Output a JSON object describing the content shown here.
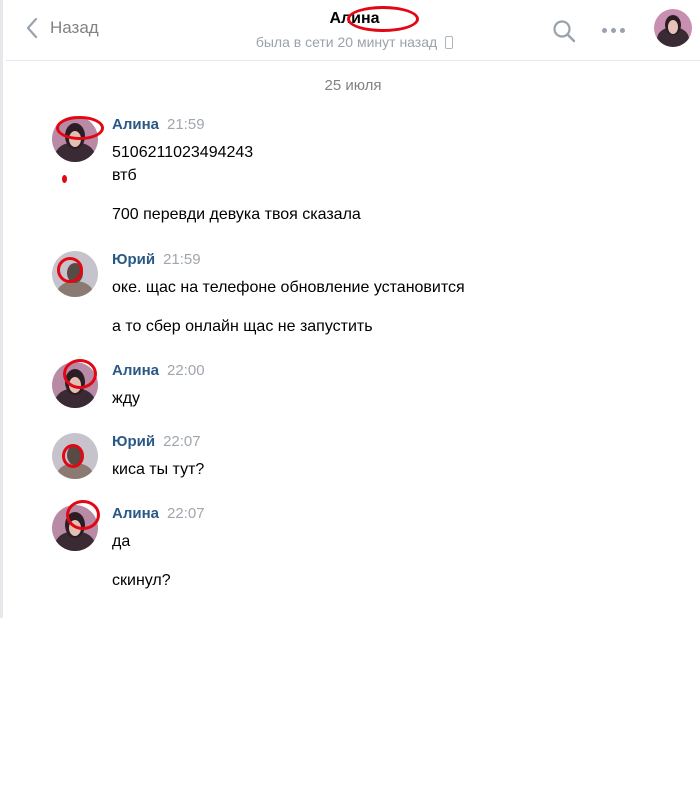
{
  "header": {
    "back_label": "Назад",
    "title": "Алина",
    "status": "была в сети 20 минут назад"
  },
  "date_separator": "25 июля",
  "messages": [
    {
      "author": "Алина",
      "time": "21:59",
      "lines": [
        "5106211023494243",
        "втб",
        "700 перевди девука твоя сказала"
      ]
    },
    {
      "author": "Юрий",
      "time": "21:59",
      "lines": [
        "оке. щас на телефоне обновление установится",
        "а то сбер онлайн щас не запустить"
      ]
    },
    {
      "author": "Алина",
      "time": "22:00",
      "lines": [
        "жду"
      ]
    },
    {
      "author": "Юрий",
      "time": "22:07",
      "lines": [
        "киса ты тут?"
      ]
    },
    {
      "author": "Алина",
      "time": "22:07",
      "lines": [
        "да",
        "скинул?"
      ]
    }
  ],
  "colors": {
    "author": "#2a5885",
    "time": "#a0a6ad",
    "muted": "#828282",
    "redaction": "#e30613"
  }
}
